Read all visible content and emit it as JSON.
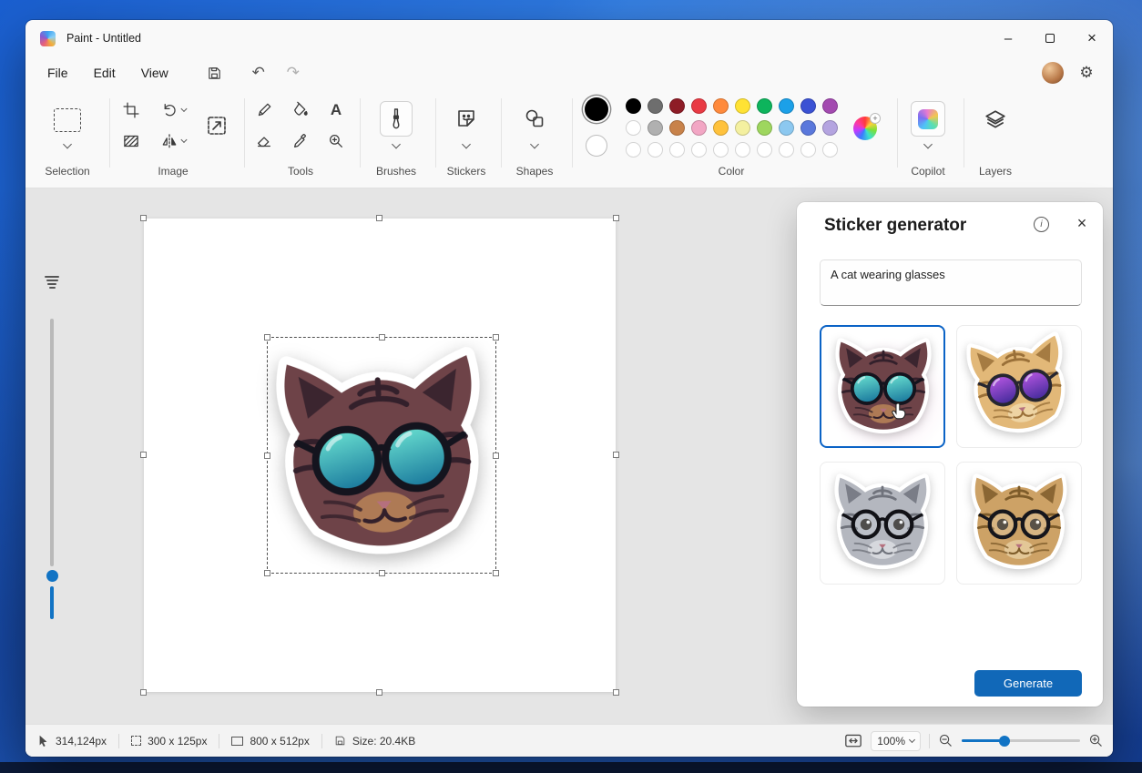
{
  "desktop": {
    "taskbar_color": "#0c1b3a"
  },
  "window": {
    "title": "Paint - Untitled",
    "minimize_glyph": "–",
    "close_glyph": "×"
  },
  "menu": {
    "items": [
      {
        "label": "File"
      },
      {
        "label": "Edit"
      },
      {
        "label": "View"
      }
    ],
    "undo_glyph": "↶",
    "redo_glyph": "↷",
    "settings_glyph": "⚙"
  },
  "ribbon": {
    "groups": {
      "selection": "Selection",
      "image": "Image",
      "tools": "Tools",
      "brushes": "Brushes",
      "stickers": "Stickers",
      "shapes": "Shapes",
      "color": "Color",
      "copilot": "Copilot",
      "layers": "Layers"
    },
    "text_tool_glyph": "A",
    "primary_color": "#000000",
    "secondary_color": "#ffffff",
    "palette_row1": [
      "#000000",
      "#6e6e6e",
      "#8e1c26",
      "#e93a44",
      "#ff8a3c",
      "#ffe234",
      "#0db45c",
      "#1ba0e8",
      "#3b52d4",
      "#a34ab0"
    ],
    "palette_row2": [
      "#ffffff",
      "#b0b0b0",
      "#c8824a",
      "#f2a6c4",
      "#ffc23c",
      "#f4f0a0",
      "#9ed65e",
      "#8cc8f0",
      "#5a78dc",
      "#b4a4e0"
    ],
    "color_wheel_plus": "+"
  },
  "sticker_panel": {
    "title": "Sticker generator",
    "info_glyph": "i",
    "close_glyph": "×",
    "prompt": "A cat wearing glasses",
    "generate_label": "Generate",
    "accent_color": "#1168b8",
    "results": [
      {
        "name": "dark-cat-teal-sunglasses",
        "selected": true,
        "glasses": "sun",
        "tilt": 0,
        "body": "#6e4348",
        "shade": "#33202b",
        "accent": "#d8a05f",
        "lens": "#6fe8d4",
        "lens2": "#1f7fa0",
        "frame": "#14141e"
      },
      {
        "name": "tan-cat-purple-sunglasses",
        "selected": false,
        "glasses": "sun",
        "tilt": -8,
        "body": "#e2b878",
        "shade": "#9a7038",
        "accent": "#f6e6c0",
        "lens": "#c05ae8",
        "lens2": "#4c2ea0",
        "frame": "#262630"
      },
      {
        "name": "gray-cat-round-glasses",
        "selected": false,
        "glasses": "round",
        "tilt": 0,
        "body": "#b4b7bf",
        "shade": "#70737c",
        "accent": "#eceef2",
        "lens": "#cfd6de",
        "lens2": "#aab2bc",
        "frame": "#111116"
      },
      {
        "name": "tabby-kitten-round-glasses",
        "selected": false,
        "glasses": "round",
        "tilt": 0,
        "body": "#cda266",
        "shade": "#7e5c2a",
        "accent": "#f2e0b8",
        "lens": "#efe6d0",
        "lens2": "#cfc4a4",
        "frame": "#16161c"
      }
    ]
  },
  "status_bar": {
    "cursor_position": "314,124px",
    "selection_size": "300  x  125px",
    "canvas_size": "800  x  512px",
    "file_size": "Size: 20.4KB",
    "zoom_level": "100%"
  }
}
